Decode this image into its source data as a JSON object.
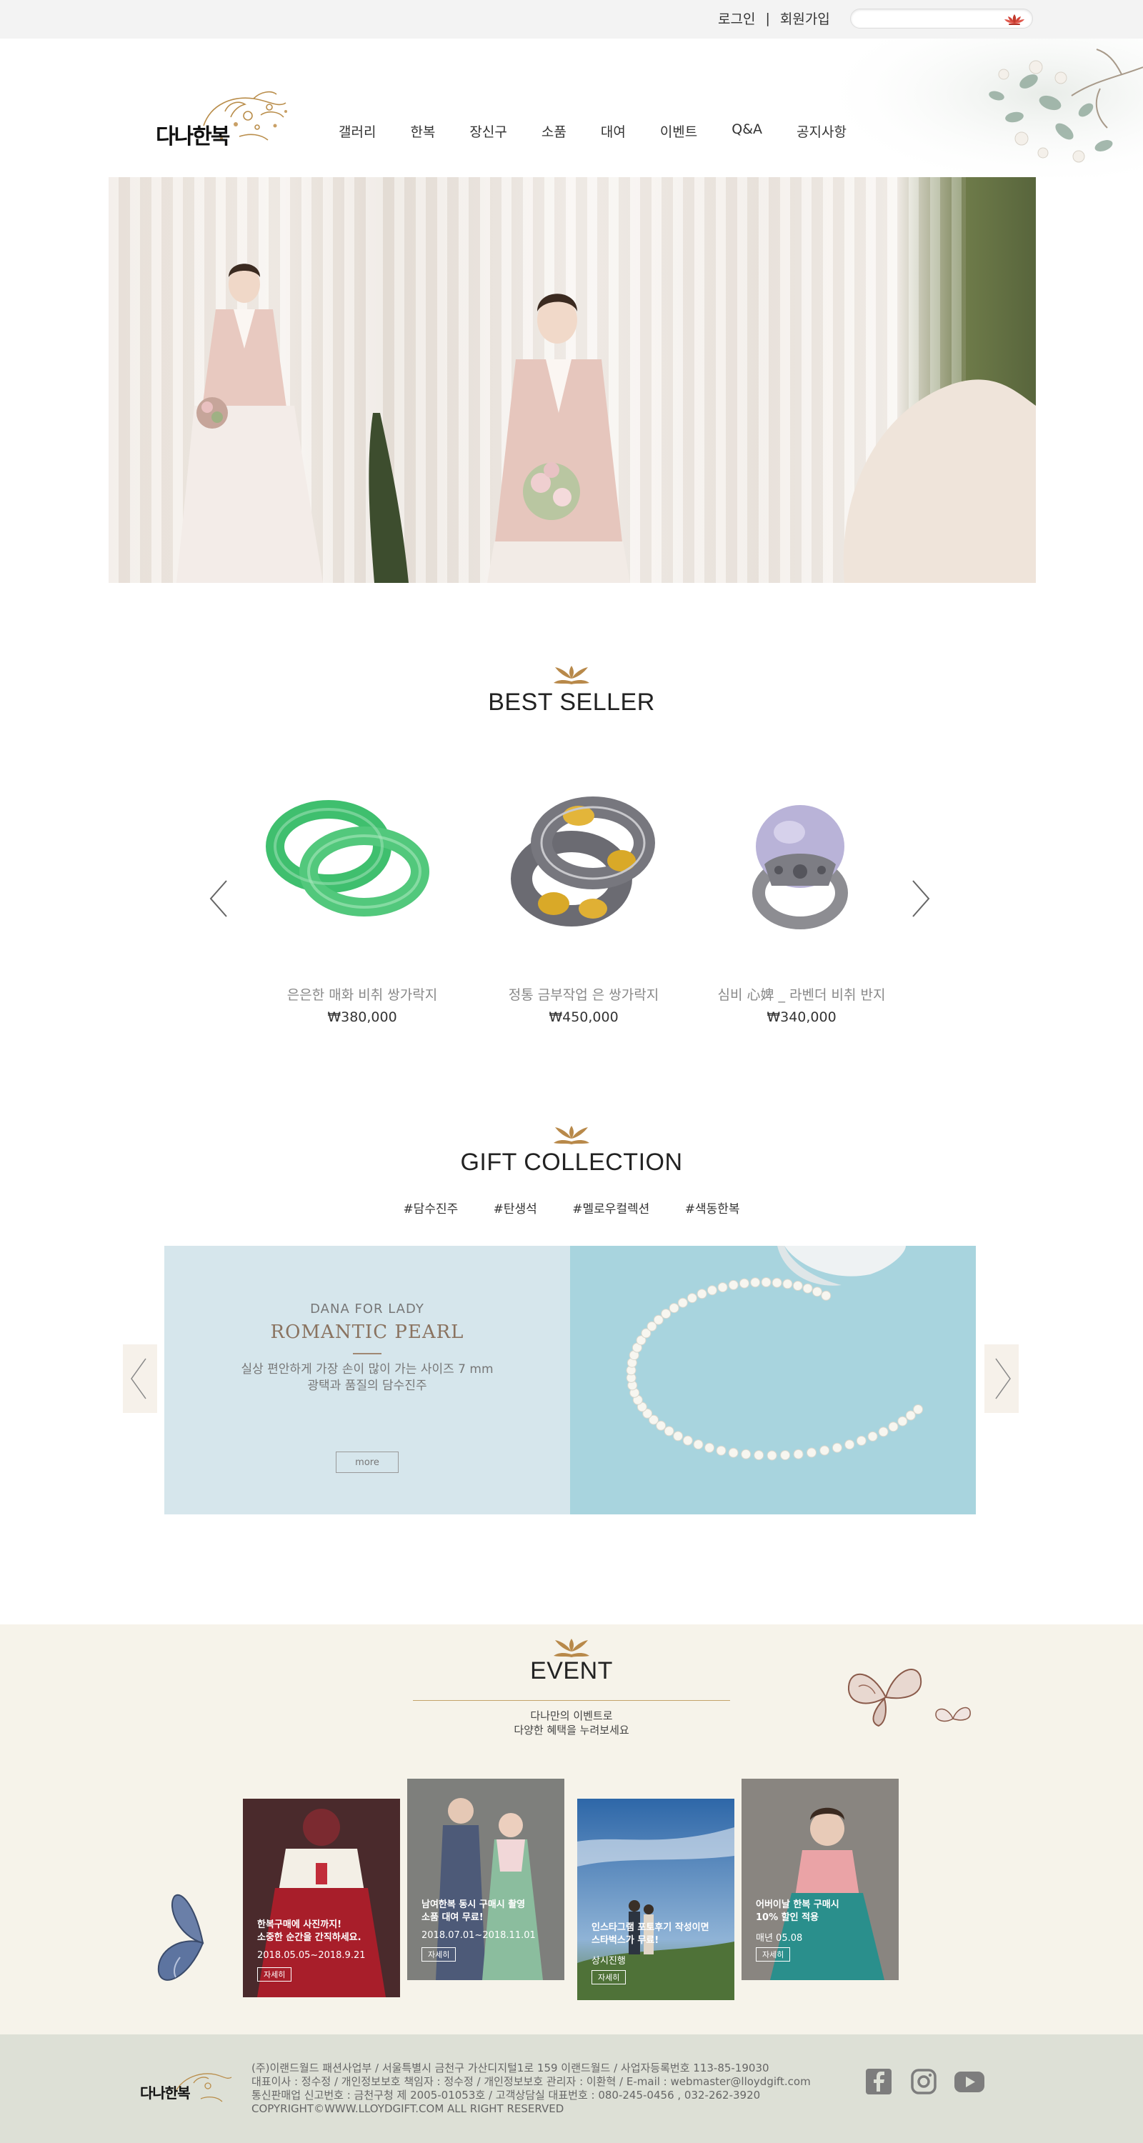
{
  "topbar": {
    "login": "로그인",
    "separator": "|",
    "signup": "회원가입",
    "search_icon": "lotus-search-icon"
  },
  "header": {
    "logo_text": "다나한복",
    "nav": [
      "갤러리",
      "한복",
      "장신구",
      "소품",
      "대여",
      "이벤트",
      "Q&A",
      "공지사항"
    ]
  },
  "best_seller": {
    "title": "BEST SELLER",
    "items": [
      {
        "name": "은은한 매화 비취 쌍가락지",
        "price": "₩380,000"
      },
      {
        "name": "정통 금부작업 은 쌍가락지",
        "price": "₩450,000"
      },
      {
        "name": "심비 心婢 _ 라벤더 비취 반지",
        "price": "₩340,000"
      }
    ]
  },
  "gift": {
    "title": "GIFT COLLECTION",
    "tags": [
      "#담수진주",
      "#탄생석",
      "#멜로우컬렉션",
      "#색동한복"
    ],
    "sub": "DANA FOR LADY",
    "headline": "ROMANTIC PEARL",
    "desc1": "실상 편안하게 가장 손이 많이 가는 사이즈 7 mm",
    "desc2": "광택과 품질의 담수진주",
    "more": "more"
  },
  "event": {
    "title": "EVENT",
    "desc1": "다나만의 이벤트로",
    "desc2": "다양한 혜택을 누려보세요",
    "cards": [
      {
        "title1": "한복구매에 사진까지!",
        "title2": "소중한 순간을 간직하세요.",
        "date": "2018.05.05~2018.9.21",
        "btn": "자세히"
      },
      {
        "title1": "남여한복 동시 구매시 촬영",
        "title2": "소품 대여 무료!",
        "date": "2018.07.01~2018.11.01",
        "btn": "자세히"
      },
      {
        "title1": "인스타그램 포토후기 작성이면",
        "title2": "스타벅스가 무료!",
        "date": "상시진행",
        "btn": "자세히"
      },
      {
        "title1": "어버이날 한복 구매시",
        "title2": "10% 할인 적용",
        "date": "매년 05.08",
        "btn": "자세히"
      }
    ]
  },
  "footer": {
    "logo_text": "다나한복",
    "line1": "(주)이랜드월드 패션사업부 / 서울특별시 금천구 가산디지털1로 159 이랜드월드 / 사업자등록번호 113-85-19030",
    "line2": "대표이사 : 정수정 / 개인정보보호 책임자 : 정수정 / 개인정보보호 관리자 : 이환혁 / E-mail : webmaster@lloydgift.com",
    "line3": "통신판매업 신고번호 : 금천구청 제 2005-01053호 / 고객상담실 대표번호 : 080-245-0456 , 032-262-3920",
    "line4": "COPYRIGHT©WWW.LLOYDGIFT.COM ALL RIGHT RESERVED",
    "social": [
      "facebook-icon",
      "instagram-icon",
      "youtube-icon"
    ]
  },
  "colors": {
    "event_bg": "#f6f3ea",
    "footer_bg": "#dde0d6",
    "gold": "#b8894a",
    "gift_left": "#d6e6ec",
    "gift_right": "#a8d4de"
  }
}
